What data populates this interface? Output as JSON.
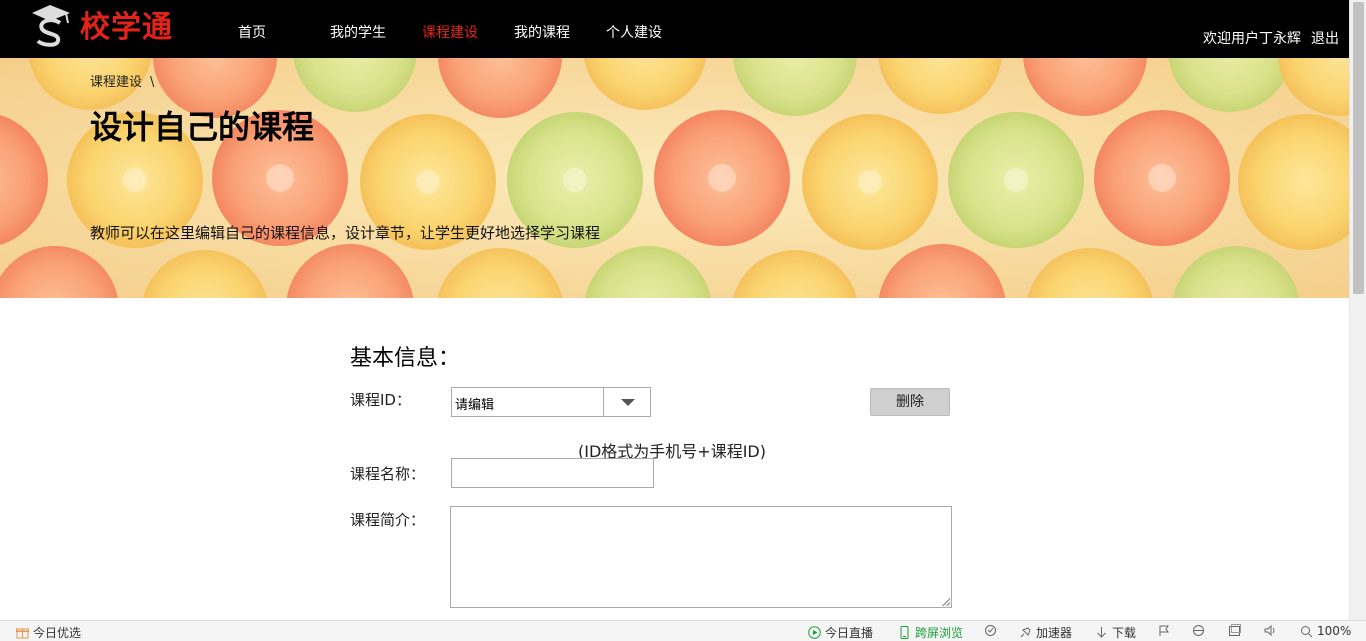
{
  "header": {
    "logo_text": "校学通",
    "nav": [
      {
        "label": "首页",
        "active": false
      },
      {
        "label": "我的学生",
        "active": false
      },
      {
        "label": "课程建设",
        "active": true
      },
      {
        "label": "我的课程",
        "active": false
      },
      {
        "label": "个人建设",
        "active": false
      }
    ],
    "welcome": "欢迎用户丁永辉",
    "logout": "退出"
  },
  "banner": {
    "breadcrumb": "课程建设",
    "breadcrumb_sep": "\\",
    "title": "设计自己的课程",
    "description": "教师可以在这里编辑自己的课程信息，设计章节，让学生更好地选择学习课程"
  },
  "form": {
    "section_title": "基本信息：",
    "course_id_label": "课程ID：",
    "course_id_value": "请编辑",
    "delete_button": "删除",
    "id_hint": "(ID格式为手机号+课程ID)",
    "course_name_label": "课程名称：",
    "course_name_value": "",
    "course_intro_label": "课程简介：",
    "course_intro_value": ""
  },
  "statusbar": {
    "left": "今日优选",
    "live": "今日直播",
    "cross_screen": "跨屏浏览",
    "accelerator": "加速器",
    "download": "下载",
    "zoom": "100%"
  },
  "colors": {
    "accent_red": "#e2231a",
    "topbar_bg": "#000000",
    "status_green": "#1a9e3a"
  }
}
